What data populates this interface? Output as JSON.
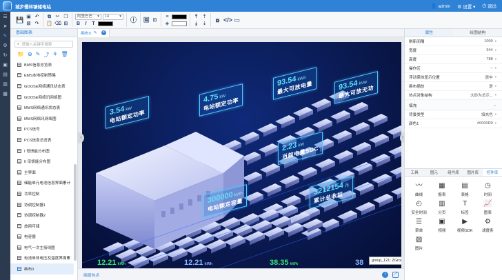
{
  "app": {
    "title": "城步儒林镇储电站"
  },
  "topbar": {
    "user": "admin",
    "settings": "设置",
    "logout": "退出"
  },
  "toolbar": {
    "font_family": "阿里巴巴",
    "font_size": "14",
    "bold": "B",
    "italic": "I",
    "text_t": "T"
  },
  "left_panel": {
    "title": "基础图表",
    "search_placeholder": "请输入关键字搜索",
    "items": [
      "BMS信息总览表",
      "EMS本地控制策略",
      "GOOSE网络通讯状态表",
      "GOOSE网络讯网络图",
      "MMS网络通讯状态表",
      "MMS网络讯网络图",
      "PCS信号",
      "PCS信息总览表",
      "I 母馈能分布图",
      "II 母馈能分布图",
      "主界面",
      "储能单元电池信息界面累计",
      "功率控制",
      "协调控制器1",
      "协调控制器2",
      "旅网可储",
      "电容器",
      "电气一次主接线图",
      "电池单体电压及温度界面累",
      "画布0"
    ],
    "selected_index": 19
  },
  "tabs": [
    {
      "label": "画布0"
    }
  ],
  "scene": {
    "labels": [
      {
        "value": "3.54",
        "unit": "kW",
        "title": "电站额定功率"
      },
      {
        "value": "4.75",
        "unit": "kW",
        "title": "电站额定功率"
      },
      {
        "value": "93.54",
        "unit": "kWh",
        "title": "最大可放电量"
      },
      {
        "value": "93.54",
        "unit": "kVar",
        "title": "最大可放无功"
      },
      {
        "value": "2.23",
        "unit": "kW",
        "title": "当前电量SOC"
      },
      {
        "value": "300000",
        "unit": "kWh",
        "title": "电站额定容量"
      },
      {
        "value": "3212154",
        "unit": "元",
        "title": "累计总收益"
      }
    ],
    "bottom_stats": [
      {
        "value": "12.21",
        "unit": "kWh"
      },
      {
        "value": "12.21",
        "unit": "kWh"
      },
      {
        "value": "38.35",
        "unit": "kWh"
      },
      {
        "value": "38",
        "unit": ""
      }
    ],
    "tooltip": "group_121: ZGroup"
  },
  "statusbar": {
    "label": "画面热点"
  },
  "right_panel": {
    "tabs": [
      "属性",
      "绘图结构"
    ],
    "active_tab": 0,
    "props": [
      {
        "key": "刷新间隔",
        "value": "1000"
      },
      {
        "key": "宽度",
        "value": "944"
      },
      {
        "key": "高度",
        "value": "788"
      },
      {
        "key": "操作区",
        "value": "--"
      },
      {
        "key": "浮动菜体显示位置",
        "value": "居中"
      },
      {
        "key": "画布缩放",
        "value": "是"
      },
      {
        "key": "热点对象结构",
        "value": "大砂为总示..."
      }
    ],
    "fill_section": "填充",
    "fill_props": [
      {
        "key": "背景类型",
        "value": "填充色"
      },
      {
        "key": "颜色1",
        "value": "#0000D0"
      }
    ],
    "component_tabs": [
      "工具",
      "图元",
      "组件库",
      "图片库",
      "控件库"
    ],
    "active_component_tab": 4,
    "components": [
      {
        "label": "曲线",
        "icon": "〰"
      },
      {
        "label": "报表",
        "icon": "▦"
      },
      {
        "label": "表格",
        "icon": "▤"
      },
      {
        "label": "时间",
        "icon": "◷"
      },
      {
        "label": "安全时间",
        "icon": "◴"
      },
      {
        "label": "分页",
        "icon": "▥"
      },
      {
        "label": "标签",
        "icon": "T"
      },
      {
        "label": "图表",
        "icon": "📈"
      },
      {
        "label": "菜单",
        "icon": "☰"
      },
      {
        "label": "视频",
        "icon": "▣"
      },
      {
        "label": "视频SDK",
        "icon": "▶"
      },
      {
        "label": "滤度条",
        "icon": "⚙"
      },
      {
        "label": "图片",
        "icon": "▨"
      }
    ]
  },
  "colors": {
    "accent": "#2f82d6",
    "scene_bg": "#0a1a52",
    "label_border": "#4fc7ff"
  }
}
